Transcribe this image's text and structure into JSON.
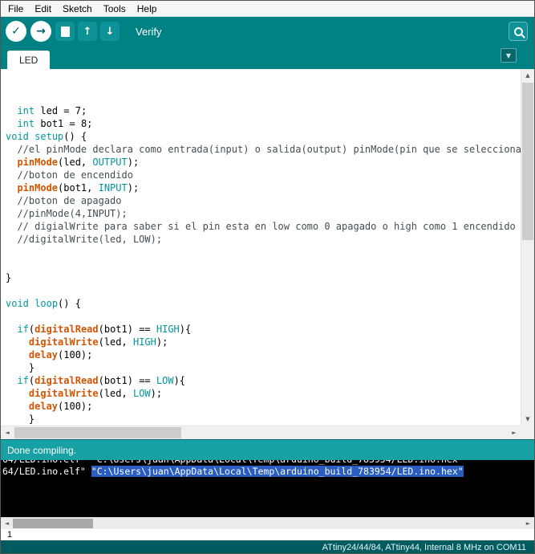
{
  "colors": {
    "toolbar_bg": "#008184",
    "status_bg": "#17A1A5",
    "footer_bg": "#005C60",
    "keyword": "#00979C",
    "function": "#D35400",
    "comment": "#434F54",
    "selection_bg": "#2A5DC0"
  },
  "menubar": {
    "items": [
      "File",
      "Edit",
      "Sketch",
      "Tools",
      "Help"
    ]
  },
  "toolbar": {
    "hover_label": "Verify",
    "buttons": [
      {
        "id": "verify",
        "glyph": "✓"
      },
      {
        "id": "upload",
        "glyph": "→"
      },
      {
        "id": "new"
      },
      {
        "id": "open",
        "glyph": "↑"
      },
      {
        "id": "save",
        "glyph": "↓"
      },
      {
        "id": "serial-monitor"
      }
    ]
  },
  "icons": {
    "up": "▲",
    "down": "▼",
    "left": "◄",
    "right": "►",
    "dropdown": "▼"
  },
  "tabs": {
    "active_label": "LED"
  },
  "editor": {
    "lines": [
      [
        [
          "p",
          "  "
        ],
        [
          "k",
          "int"
        ],
        [
          "p",
          " led = 7;"
        ]
      ],
      [
        [
          "p",
          "  "
        ],
        [
          "k",
          "int"
        ],
        [
          "p",
          " bot1 = 8;"
        ]
      ],
      [
        [
          "k",
          "void"
        ],
        [
          "p",
          " "
        ],
        [
          "k",
          "setup"
        ],
        [
          "p",
          "() {"
        ]
      ],
      [
        [
          "p",
          "  "
        ],
        [
          "c",
          "//el pinMode declara como entrada(input) o salida(output) pinMode(pin que se selecciona, m"
        ]
      ],
      [
        [
          "p",
          "  "
        ],
        [
          "f",
          "pinMode"
        ],
        [
          "p",
          "(led, "
        ],
        [
          "k",
          "OUTPUT"
        ],
        [
          "p",
          ");"
        ]
      ],
      [
        [
          "p",
          "  "
        ],
        [
          "c",
          "//boton de encendido"
        ]
      ],
      [
        [
          "p",
          "  "
        ],
        [
          "f",
          "pinMode"
        ],
        [
          "p",
          "(bot1, "
        ],
        [
          "k",
          "INPUT"
        ],
        [
          "p",
          ");"
        ]
      ],
      [
        [
          "p",
          "  "
        ],
        [
          "c",
          "//boton de apagado"
        ]
      ],
      [
        [
          "p",
          "  "
        ],
        [
          "c",
          "//pinMode(4,INPUT);"
        ]
      ],
      [
        [
          "p",
          "  "
        ],
        [
          "c",
          "// digialWrite para saber si el pin esta en low como 0 apagado o high como 1 encendido"
        ]
      ],
      [
        [
          "p",
          "  "
        ],
        [
          "c",
          "//digitalWrite(led, LOW);"
        ]
      ],
      [],
      [],
      [
        [
          "p",
          "}"
        ]
      ],
      [],
      [
        [
          "k",
          "void"
        ],
        [
          "p",
          " "
        ],
        [
          "k",
          "loop"
        ],
        [
          "p",
          "() {"
        ]
      ],
      [],
      [
        [
          "p",
          "  "
        ],
        [
          "k",
          "if"
        ],
        [
          "p",
          "("
        ],
        [
          "f",
          "digitalRead"
        ],
        [
          "p",
          "(bot1) == "
        ],
        [
          "k",
          "HIGH"
        ],
        [
          "p",
          "){"
        ]
      ],
      [
        [
          "p",
          "    "
        ],
        [
          "f",
          "digitalWrite"
        ],
        [
          "p",
          "(led, "
        ],
        [
          "k",
          "HIGH"
        ],
        [
          "p",
          ");"
        ]
      ],
      [
        [
          "p",
          "    "
        ],
        [
          "f",
          "delay"
        ],
        [
          "p",
          "(100);"
        ]
      ],
      [
        [
          "p",
          "    }"
        ]
      ],
      [
        [
          "p",
          "  "
        ],
        [
          "k",
          "if"
        ],
        [
          "p",
          "("
        ],
        [
          "f",
          "digitalRead"
        ],
        [
          "p",
          "(bot1) == "
        ],
        [
          "k",
          "LOW"
        ],
        [
          "p",
          "){"
        ]
      ],
      [
        [
          "p",
          "    "
        ],
        [
          "f",
          "digitalWrite"
        ],
        [
          "p",
          "(led, "
        ],
        [
          "k",
          "LOW"
        ],
        [
          "p",
          ");"
        ]
      ],
      [
        [
          "p",
          "    "
        ],
        [
          "f",
          "delay"
        ],
        [
          "p",
          "(100);"
        ]
      ],
      [
        [
          "p",
          "    }"
        ]
      ],
      [
        [
          "p",
          "}"
        ]
      ]
    ]
  },
  "statusbar": {
    "message": "Done compiling."
  },
  "console": {
    "clipped_fragment": "64/LED.ino.elf\" \"C:\\Users\\juan\\AppData\\Local\\Temp\\arduino_build_783954/LED.ino.hex\"",
    "line": {
      "prefix": "64/LED.ino.elf\" ",
      "selected": "\"C:\\Users\\juan\\AppData\\Local\\Temp\\arduino_build_783954/LED.ino.hex\""
    }
  },
  "footer": {
    "line_number": "1",
    "board_info": "ATtiny24/44/84, ATtiny44, Internal 8 MHz on COM11"
  }
}
